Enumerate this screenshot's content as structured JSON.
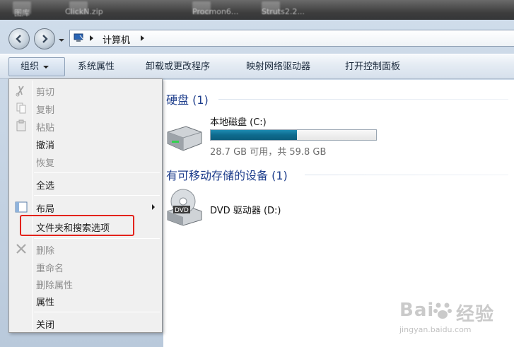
{
  "desktop": {
    "labels": [
      "图库",
      "ClickN.zip",
      "Procmon6...",
      "Struts2.2..."
    ]
  },
  "address": {
    "path": [
      "计算机"
    ]
  },
  "toolbar": {
    "organize": "组织",
    "items": [
      "系统属性",
      "卸载或更改程序",
      "映射网络驱动器",
      "打开控制面板"
    ]
  },
  "menu": {
    "items": [
      {
        "label": "剪切",
        "disabled": true,
        "icon": "scissors-icon"
      },
      {
        "label": "复制",
        "disabled": true,
        "icon": "copy-icon"
      },
      {
        "label": "粘贴",
        "disabled": true,
        "icon": "paste-icon"
      },
      {
        "label": "撤消",
        "disabled": false
      },
      {
        "label": "恢复",
        "disabled": true
      },
      {
        "label": "全选",
        "disabled": false
      },
      {
        "label": "布局",
        "disabled": false,
        "icon": "layout-icon",
        "submenu": true
      },
      {
        "label": "文件夹和搜索选项",
        "disabled": false,
        "highlighted": true
      },
      {
        "label": "删除",
        "disabled": true,
        "icon": "delete-icon"
      },
      {
        "label": "重命名",
        "disabled": true
      },
      {
        "label": "删除属性",
        "disabled": true
      },
      {
        "label": "属性",
        "disabled": false
      },
      {
        "label": "关闭",
        "disabled": false
      }
    ]
  },
  "content": {
    "hard_disks": {
      "title": "硬盘 (1)"
    },
    "local_disk": {
      "name": "本地磁盘 (C:)",
      "used_fraction": 0.52,
      "size_text": "28.7 GB 可用，共 59.8 GB"
    },
    "removable": {
      "title": "有可移动存储的设备 (1)"
    },
    "dvd": {
      "name": "DVD 驱动器 (D:)"
    }
  },
  "colors": {
    "highlight_box": "#e3221b",
    "group_title": "#1e3e8c",
    "drive_fill": "#0e6b8e"
  },
  "watermark": {
    "main": "Bai",
    "main2": "经验",
    "sub": "jingyan.baidu.com"
  }
}
